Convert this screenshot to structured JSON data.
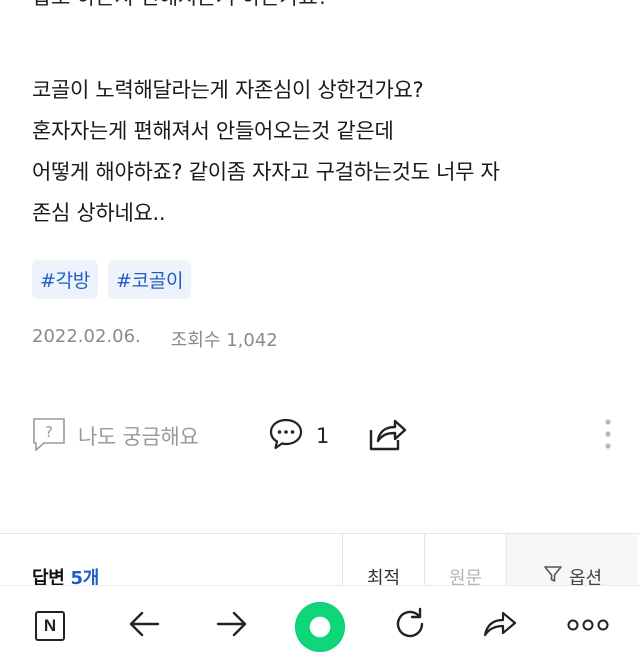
{
  "post": {
    "cut_line": "합보 하는지 편해지는거 하는가요?",
    "lines": [
      "코골이 노력해달라는게 자존심이 상한건가요?",
      "혼자자는게 편해져서 안들어오는것 같은데",
      "어떻게 해야하죠? 같이좀 자자고 구걸하는것도 너무 자",
      "존심 상하네요.."
    ],
    "tags": [
      "#각방",
      "#코골이"
    ],
    "date": "2022.02.06.",
    "views": "조회수 1,042"
  },
  "actions": {
    "curious_label": "나도 궁금해요",
    "comment_count": "1"
  },
  "answers": {
    "title": "답변",
    "count": "5개",
    "sort_tabs": [
      "최적",
      "원문"
    ],
    "options_label": "옵션"
  },
  "colors": {
    "tag_text": "#1f5ec4",
    "tag_bg": "#eef3fb",
    "accent_green": "#10d67a"
  }
}
